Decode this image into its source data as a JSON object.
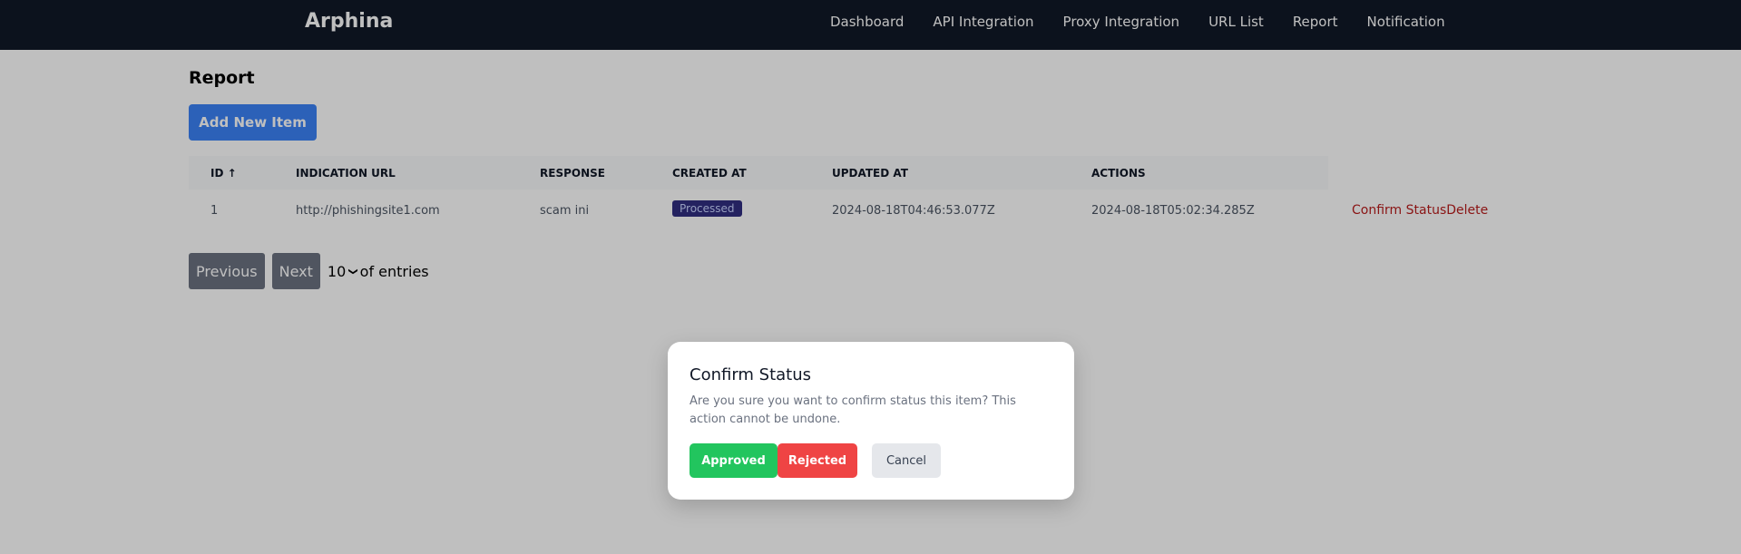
{
  "navbar": {
    "brand": "Arphina",
    "links": [
      "Dashboard",
      "API Integration",
      "Proxy Integration",
      "URL List",
      "Report",
      "Notification"
    ]
  },
  "page": {
    "title": "Report",
    "add_button": "Add New Item"
  },
  "table": {
    "headers": [
      "ID ↑",
      "Indication URL",
      "Response",
      "Created At",
      "Updated At",
      "Actions"
    ],
    "rows": [
      {
        "id": "1",
        "url": "http://phishingsite1.com",
        "response": "scam ini",
        "status": "Processed",
        "created_at": "2024-08-18T04:46:53.077Z",
        "updated_at": "2024-08-18T05:02:34.285Z",
        "action_confirm": "Confirm Status",
        "action_delete": "Delete"
      }
    ]
  },
  "pagination": {
    "previous": "Previous",
    "next": "Next",
    "page_size": "10",
    "suffix": "of entries"
  },
  "modal": {
    "title": "Confirm Status",
    "message": "Are you sure you want to confirm status this item? This action cannot be undone.",
    "approve": "Approved",
    "reject": "Rejected",
    "cancel": "Cancel"
  },
  "colors": {
    "navbar_bg": "#111827",
    "primary": "#3b82f6",
    "badge_bg": "#312e81",
    "danger_link": "#b91c1c",
    "approve": "#22c55e",
    "reject": "#ef4444"
  }
}
